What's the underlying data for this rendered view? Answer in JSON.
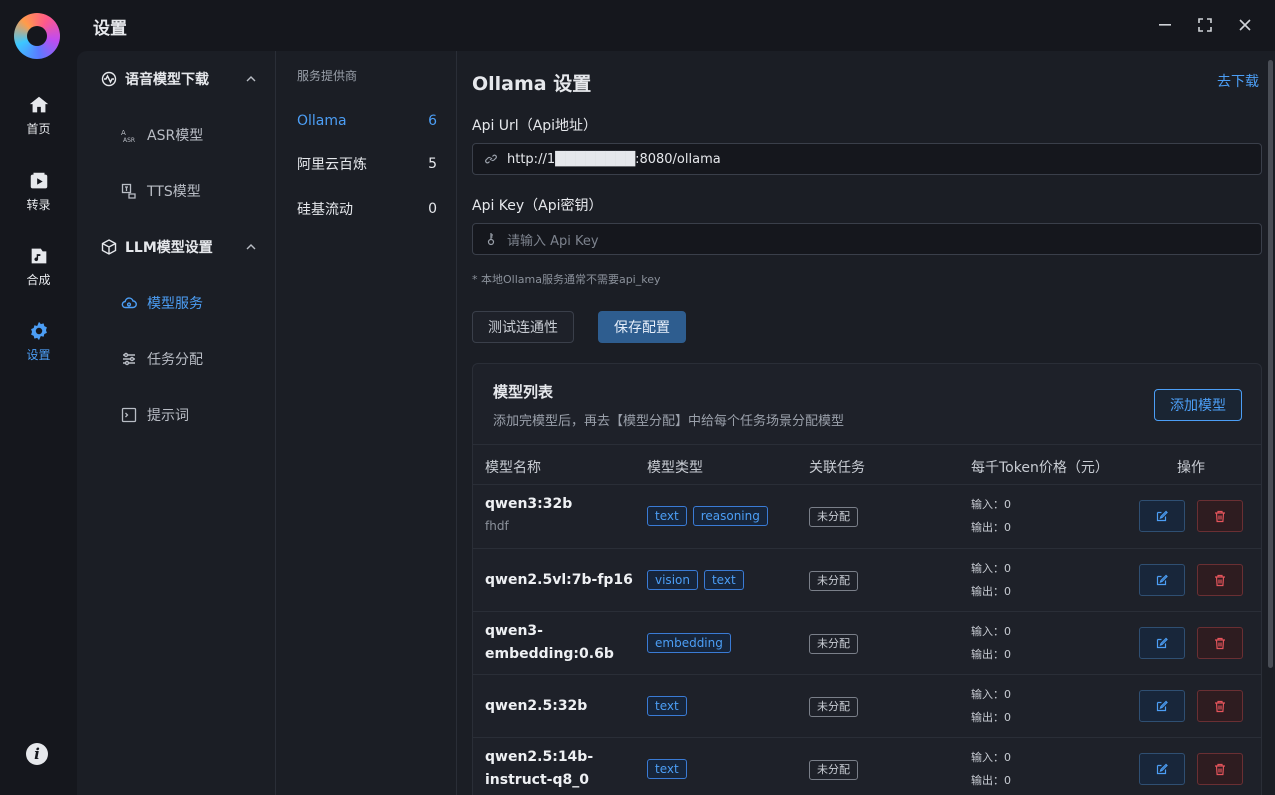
{
  "window": {
    "title": "设置"
  },
  "rail": [
    {
      "label": "首页",
      "icon": "home-icon"
    },
    {
      "label": "转录",
      "icon": "transcribe-icon"
    },
    {
      "label": "合成",
      "icon": "synthesis-icon"
    },
    {
      "label": "设置",
      "icon": "gear-icon",
      "active": true
    }
  ],
  "nav": {
    "group1": "语音模型下载",
    "asr": "ASR模型",
    "tts": "TTS模型",
    "group2": "LLM模型设置",
    "model_service": "模型服务",
    "task_assign": "任务分配",
    "prompts": "提示词"
  },
  "providers": {
    "header": "服务提供商",
    "items": [
      {
        "name": "Ollama",
        "count": "6",
        "active": true
      },
      {
        "name": "阿里云百炼",
        "count": "5"
      },
      {
        "name": "硅基流动",
        "count": "0"
      }
    ]
  },
  "main": {
    "title": "Ollama 设置",
    "download_link": "去下载",
    "api_url_label": "Api Url（Api地址）",
    "api_url_value": "http://1████████:8080/ollama",
    "api_key_label": "Api Key（Api密钥）",
    "api_key_placeholder": "请输入 Api Key",
    "hint": "* 本地Ollama服务通常不需要api_key",
    "test_button": "测试连通性",
    "save_button": "保存配置"
  },
  "model_list": {
    "title": "模型列表",
    "subtitle": "添加完模型后，再去【模型分配】中给每个任务场景分配模型",
    "add_button": "添加模型",
    "columns": [
      "模型名称",
      "模型类型",
      "关联任务",
      "每千Token价格（元）",
      "操作"
    ],
    "rows": [
      {
        "name": "qwen3:32b",
        "sub": "fhdf",
        "tags": [
          "text",
          "reasoning"
        ],
        "assign": "未分配",
        "in": "输入：0",
        "out": "输出：0"
      },
      {
        "name": "qwen2.5vl:7b-fp16",
        "sub": "",
        "tags": [
          "vision",
          "text"
        ],
        "assign": "未分配",
        "in": "输入：0",
        "out": "输出：0"
      },
      {
        "name": "qwen3-embedding:0.6b",
        "name_l1": "qwen3-",
        "name_l2": "embedding:0.6b",
        "sub": "",
        "tags": [
          "embedding"
        ],
        "assign": "未分配",
        "in": "输入：0",
        "out": "输出：0"
      },
      {
        "name": "qwen2.5:32b",
        "sub": "",
        "tags": [
          "text"
        ],
        "assign": "未分配",
        "in": "输入：0",
        "out": "输出：0"
      },
      {
        "name": "qwen2.5:14b-instruct-q8_0",
        "name_l1": "qwen2.5:14b-",
        "name_l2": "instruct-q8_0",
        "sub": "",
        "tags": [
          "text"
        ],
        "assign": "未分配",
        "in": "输入：0",
        "out": "输出：0"
      }
    ]
  },
  "colors": {
    "accent": "#4c9ef5",
    "danger": "#e5545b",
    "background": "#15171d",
    "panel": "#1b1e25"
  }
}
